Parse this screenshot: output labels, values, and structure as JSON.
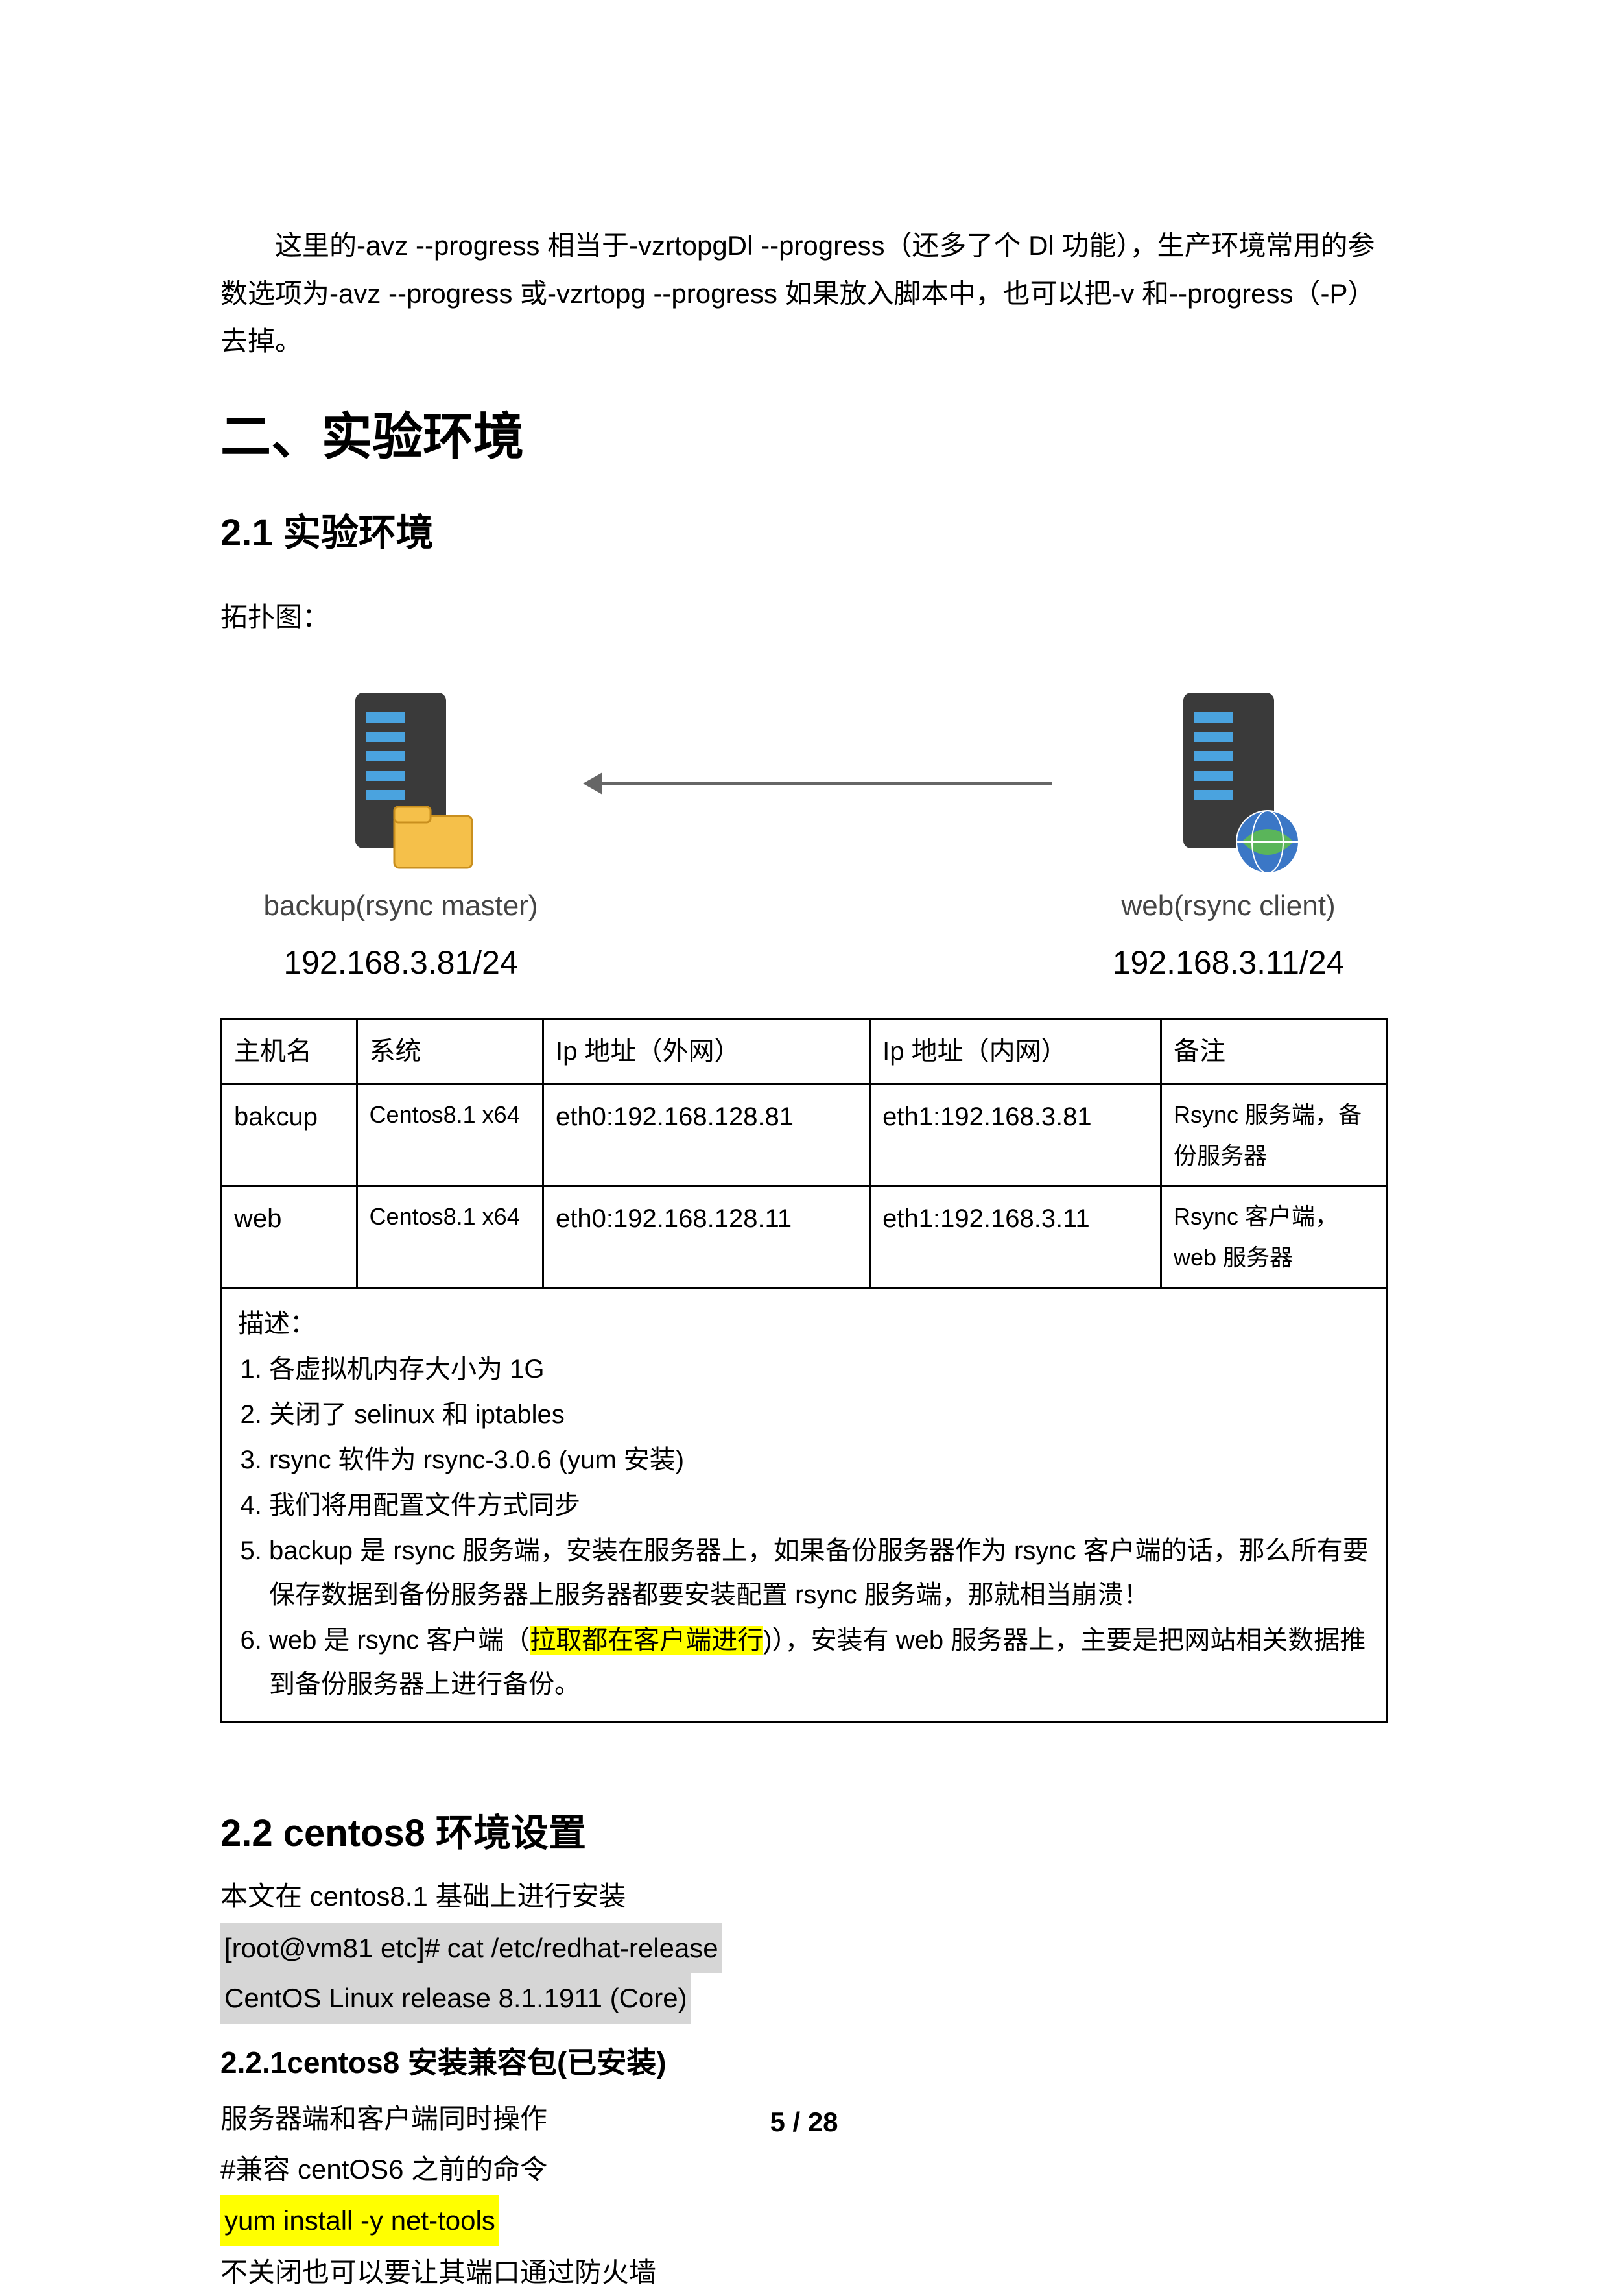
{
  "intro": "这里的-avz --progress 相当于-vzrtopgDl --progress（还多了个 Dl 功能），生产环境常用的参数选项为-avz --progress 或-vzrtopg --progress 如果放入脚本中，也可以把-v 和--progress（-P）去掉。",
  "h1": "二、实验环境",
  "h2_1": "2.1 实验环境",
  "topology_label": "拓扑图：",
  "diagram": {
    "left": {
      "label": "backup(rsync master)",
      "ip": "192.168.3.81/24"
    },
    "right": {
      "label": "web(rsync  client)",
      "ip": "192.168.3.11/24"
    }
  },
  "table": {
    "headers": [
      "主机名",
      "系统",
      "Ip 地址（外网）",
      "Ip 地址（内网）",
      "备注"
    ],
    "rows": [
      [
        "bakcup",
        "Centos8.1 x64",
        "eth0:192.168.128.81",
        "eth1:192.168.3.81",
        "Rsync 服务端，备份服务器"
      ],
      [
        "web",
        "Centos8.1 x64",
        "eth0:192.168.128.11",
        "eth1:192.168.3.11",
        "Rsync 客户端，web 服务器"
      ]
    ],
    "desc_title": "描述：",
    "desc_items": [
      "各虚拟机内存大小为 1G",
      "关闭了 selinux 和 iptables",
      "rsync 软件为 rsync-3.0.6 (yum 安装)",
      "我们将用配置文件方式同步"
    ],
    "desc_item5_pre": "backup 是 rsync 服务端，安装在服务器上，如果备份服务器作为 rsync 客户端的话，那么所有要保存数据到备份服务器上服务器都要安装配置 rsync 服务端，那就相当崩溃！",
    "desc_item6_pre": "web 是 rsync 客户端（",
    "desc_item6_hl": "拉取都在客户端进行",
    "desc_item6_post": ")），安装有 web 服务器上，主要是把网站相关数据推到备份服务器上进行备份。"
  },
  "h2_2": "2.2 centos8 环境设置",
  "s22_line1": "本文在 centos8.1 基础上进行安装",
  "s22_code1": "[root@vm81 etc]# cat /etc/redhat-release",
  "s22_code2": "CentOS Linux release 8.1.1911 (Core)",
  "h3_221": "2.2.1centos8 安装兼容包(已安装)",
  "s221_line1": "服务器端和客户端同时操作",
  "s221_line2": "#兼容 centOS6 之前的命令",
  "s221_code": "yum install -y net-tools",
  "s221_line3": "不关闭也可以要让其端口通过防火墙",
  "footer": "5 / 28"
}
